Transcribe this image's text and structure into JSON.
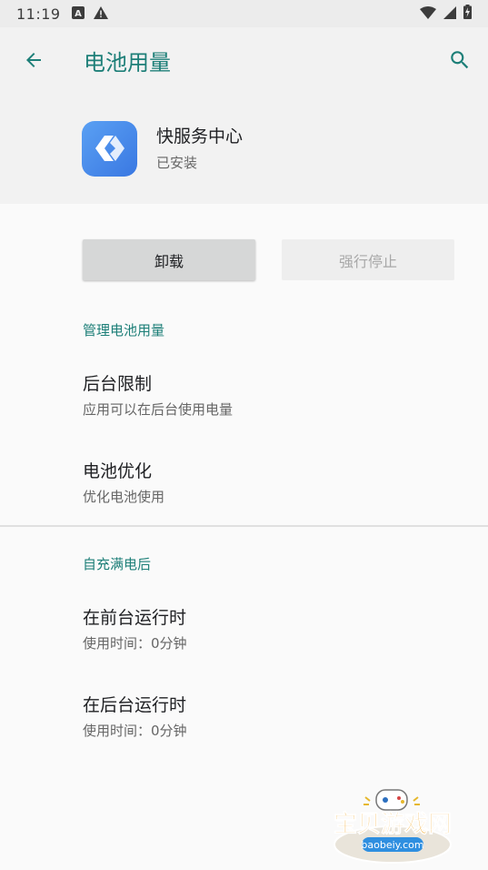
{
  "status_bar": {
    "time": "11:19"
  },
  "app_bar": {
    "title": "电池用量"
  },
  "app": {
    "name": "快服务中心",
    "status": "已安装"
  },
  "buttons": {
    "uninstall": "卸载",
    "force_stop": "强行停止"
  },
  "manage_section": {
    "header": "管理电池用量",
    "items": [
      {
        "title": "后台限制",
        "subtitle": "应用可以在后台使用电量"
      },
      {
        "title": "电池优化",
        "subtitle": "优化电池使用"
      }
    ]
  },
  "since_charge_section": {
    "header": "自充满电后",
    "items": [
      {
        "title": "在前台运行时",
        "subtitle": "使用时间：0分钟"
      },
      {
        "title": "在后台运行时",
        "subtitle": "使用时间：0分钟"
      }
    ]
  },
  "watermark": {
    "brand": "宝贝游戏网",
    "domain": "baobeiy.com"
  },
  "colors": {
    "accent": "#1d7f78",
    "app_icon": "#3a78e2"
  }
}
